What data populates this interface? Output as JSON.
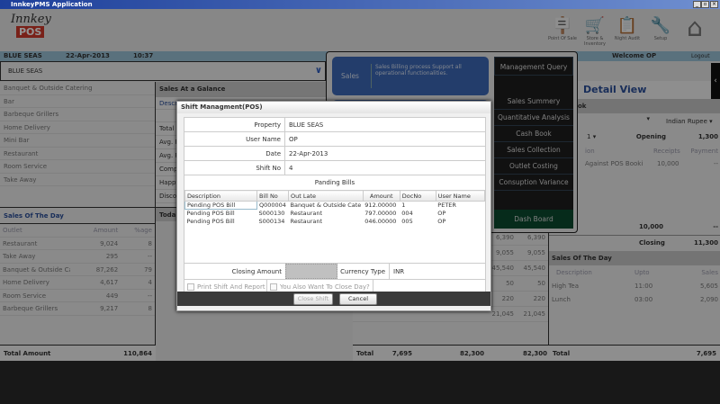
{
  "app": {
    "title": "InnkeyPMS Application",
    "logo_text": "Innkey POS"
  },
  "toolbar": [
    {
      "label": "Point Of Sale",
      "icon": "open-sign-icon"
    },
    {
      "label": "Store & Inventory",
      "icon": "cart-icon"
    },
    {
      "label": "Night Audit",
      "icon": "clipboard-icon"
    },
    {
      "label": "Setup",
      "icon": "tools-icon"
    },
    {
      "label": "",
      "icon": "home-icon"
    }
  ],
  "infobar": {
    "property": "BLUE SEAS",
    "date": "22-Apr-2013",
    "time": "10:37",
    "welcome": "Welcome OP",
    "logout": "Logout"
  },
  "property_select": "BLUE SEAS",
  "outlets": [
    "Banquet & Outside Catering",
    "Bar",
    "Barbeque Grillers",
    "Home Delivery",
    "Mini Bar",
    "Restaurant",
    "Room Service",
    "Take Away"
  ],
  "glance": {
    "title": "Sales At a Galance",
    "rows": [
      "Descri",
      "",
      "Total S",
      "Avg. P",
      "Avg. P",
      "Comp",
      "Happy",
      "Disco"
    ],
    "today": "Toda"
  },
  "sales_of_day": {
    "title": "Sales Of The Day",
    "headers": [
      "Outlet",
      "Amount",
      "%age"
    ],
    "rows": [
      [
        "Restaurant",
        "9,024",
        "8"
      ],
      [
        "Take Away",
        "295",
        "--"
      ],
      [
        "Banquet & Outside Cat",
        "87,262",
        "79"
      ],
      [
        "Home Delivery",
        "4,617",
        "4"
      ],
      [
        "Room Service",
        "449",
        "--"
      ],
      [
        "Barbeque Grillers",
        "9,217",
        "8"
      ]
    ],
    "total_label": "Total Amount",
    "total": "110,864"
  },
  "mid": {
    "rows": [
      [
        "6,390",
        "6,390"
      ],
      [
        "9,055",
        "9,055"
      ],
      [
        "45,540",
        "45,540"
      ],
      [
        "50",
        "50"
      ],
      [
        "220",
        "220"
      ],
      [
        "21,045",
        "21,045"
      ]
    ],
    "total": [
      "Total",
      "7,695",
      "82,300",
      "82,300"
    ]
  },
  "right": {
    "detail_view": "Detail View",
    "section": "ok",
    "currency": "Indian Rupee",
    "shift": "1",
    "opening_label": "Opening",
    "opening": "1,300",
    "headers": [
      "ion",
      "Receipts",
      "Payment"
    ],
    "row": [
      "Against POS Booki",
      "10,000",
      "--"
    ],
    "sum": [
      "10,000",
      "--"
    ],
    "closing_label": "Closing",
    "closing": "11,300",
    "sod_title": "Sales Of The Day",
    "sod_headers": [
      "Description",
      "Upto",
      "Sales"
    ],
    "sod_rows": [
      [
        "High Tea",
        "11:00",
        "5,605"
      ],
      [
        "Lunch",
        "03:00",
        "2,090"
      ]
    ],
    "total": [
      "Total",
      "7,695"
    ]
  },
  "popup": {
    "sales_title": "Sales",
    "sales_desc": "Sales Billing process Support all operational functionalities.",
    "menu_title": "Management Query",
    "items": [
      "Sales Summery",
      "Quantitative Analysis",
      "Cash Book",
      "Sales Collection",
      "Outlet Costing",
      "Consuption Variance"
    ],
    "dashboard": "Dash Board"
  },
  "modal": {
    "title": "Shift Managment(POS)",
    "fields": [
      {
        "label": "Property",
        "value": "BLUE SEAS"
      },
      {
        "label": "User Name",
        "value": "OP"
      },
      {
        "label": "Date",
        "value": "22-Apr-2013"
      },
      {
        "label": "Shift No",
        "value": "4"
      }
    ],
    "pending_title": "Panding Bills",
    "headers": [
      "Description",
      "Bill No",
      "Out Late",
      "Amount",
      "DocNo",
      "User Name"
    ],
    "rows": [
      [
        "Pending POS Bill",
        "Q000004",
        "Banquet & Outside Cate",
        "912.00000",
        "1",
        "PETER"
      ],
      [
        "Pending POS Bill",
        "S000130",
        "Restaurant",
        "797.00000",
        "004",
        "OP"
      ],
      [
        "Pending POS Bill",
        "S000134",
        "Restaurant",
        "046.00000",
        "005",
        "OP"
      ]
    ],
    "closing_amount_label": "Closing Amount",
    "closing_amount": "",
    "currency_label": "Currency Type",
    "currency": "INR",
    "print_label": "Print Shift And Report",
    "close_day_label": "You Also Want To Close Day?",
    "close_shift": "Close Shift",
    "cancel": "Cancel"
  }
}
